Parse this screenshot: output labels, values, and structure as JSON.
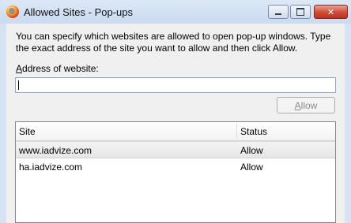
{
  "window": {
    "title": "Allowed Sites - Pop-ups",
    "minimize_label": "",
    "maximize_label": "",
    "close_label": "✕"
  },
  "description": "You can specify which websites are allowed to open pop-up windows. Type the exact address of the site you want to allow and then click Allow.",
  "address": {
    "label_accel": "A",
    "label_rest": "ddress of website:",
    "value": "",
    "placeholder": ""
  },
  "allow_button": {
    "accel": "A",
    "rest": "llow",
    "enabled": false
  },
  "list": {
    "columns": [
      "Site",
      "Status"
    ],
    "rows": [
      {
        "site": "www.iadvize.com",
        "status": "Allow",
        "selected": true
      },
      {
        "site": "ha.iadvize.com",
        "status": "Allow",
        "selected": false
      }
    ]
  },
  "colors": {
    "titlebar": "#c9dbef",
    "close": "#cf4b36",
    "input_border": "#8aa7cf"
  }
}
